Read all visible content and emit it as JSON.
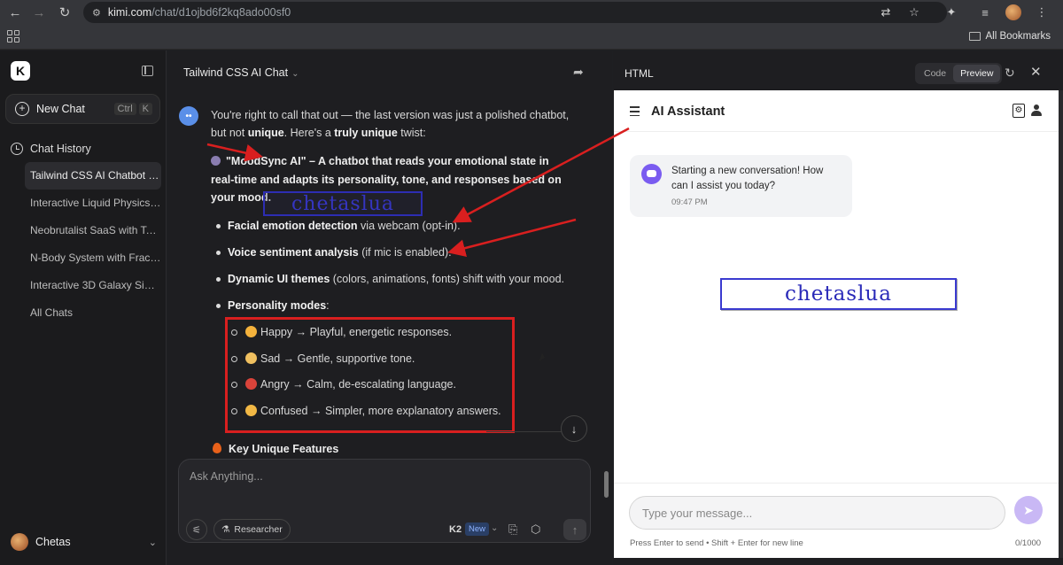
{
  "browser": {
    "url_host": "kimi.com",
    "url_path": "/chat/d1ojbd6f2kq8ado00sf0",
    "all_bookmarks": "All Bookmarks"
  },
  "sidebar": {
    "logo": "K",
    "new_chat": "New Chat",
    "shortcut_ctrl": "Ctrl",
    "shortcut_key": "K",
    "history_title": "Chat History",
    "items": [
      {
        "label": "Tailwind CSS AI Chatbot W..."
      },
      {
        "label": "Interactive Liquid Physics S..."
      },
      {
        "label": "Neobrutalist SaaS with Tail..."
      },
      {
        "label": "N-Body System with Fractal..."
      },
      {
        "label": "Interactive 3D Galaxy Simul..."
      },
      {
        "label": "All Chats"
      }
    ],
    "user": "Chetas"
  },
  "chat": {
    "title": "Tailwind CSS AI Chat",
    "intro_1": "You're right to call that out — the last version was just a polished chatbot, but not ",
    "intro_bold": "unique",
    "intro_2": ". Here's a ",
    "intro_bold2": "truly unique",
    "intro_3": " twist:",
    "moodsync": "\"MoodSync AI\" – A chatbot that reads your emotional state in real-time and adapts its personality, tone, and responses based on your mood.",
    "bullets": [
      {
        "bold": "Facial emotion detection",
        "rest": " via webcam (opt-in)."
      },
      {
        "bold": "Voice sentiment analysis",
        "rest": " (if mic is enabled)."
      },
      {
        "bold": "Dynamic UI themes",
        "rest": " (colors, animations, fonts) shift with your mood."
      },
      {
        "bold": "Personality modes",
        "rest": ":"
      }
    ],
    "modes": [
      {
        "text": "Happy → Playful, energetic responses.",
        "color": "#f4b23c"
      },
      {
        "text": "Sad → Gentle, supportive tone.",
        "color": "#f0c060"
      },
      {
        "text": "Angry → Calm, de-escalating language.",
        "color": "#d9433a"
      },
      {
        "text": "Confused → Simpler, more explanatory answers.",
        "color": "#f2b845"
      }
    ],
    "key_features": "Key Unique Features",
    "watermark": "chetaslua",
    "composer_placeholder": "Ask Anything...",
    "researcher": "Researcher",
    "model": "K2",
    "model_badge": "New"
  },
  "panel": {
    "title": "HTML",
    "tab_code": "Code",
    "tab_preview": "Preview",
    "preview": {
      "title": "AI Assistant",
      "message": "Starting a new conversation! How can I assist you today?",
      "time": "09:47 PM",
      "watermark": "chetaslua",
      "input_placeholder": "Type your message...",
      "hint": "Press Enter to send • Shift + Enter for new line",
      "count": "0/1000"
    }
  },
  "colors": {
    "annotation_red": "#d91f1f",
    "accent_purple": "#7a5cf0"
  }
}
